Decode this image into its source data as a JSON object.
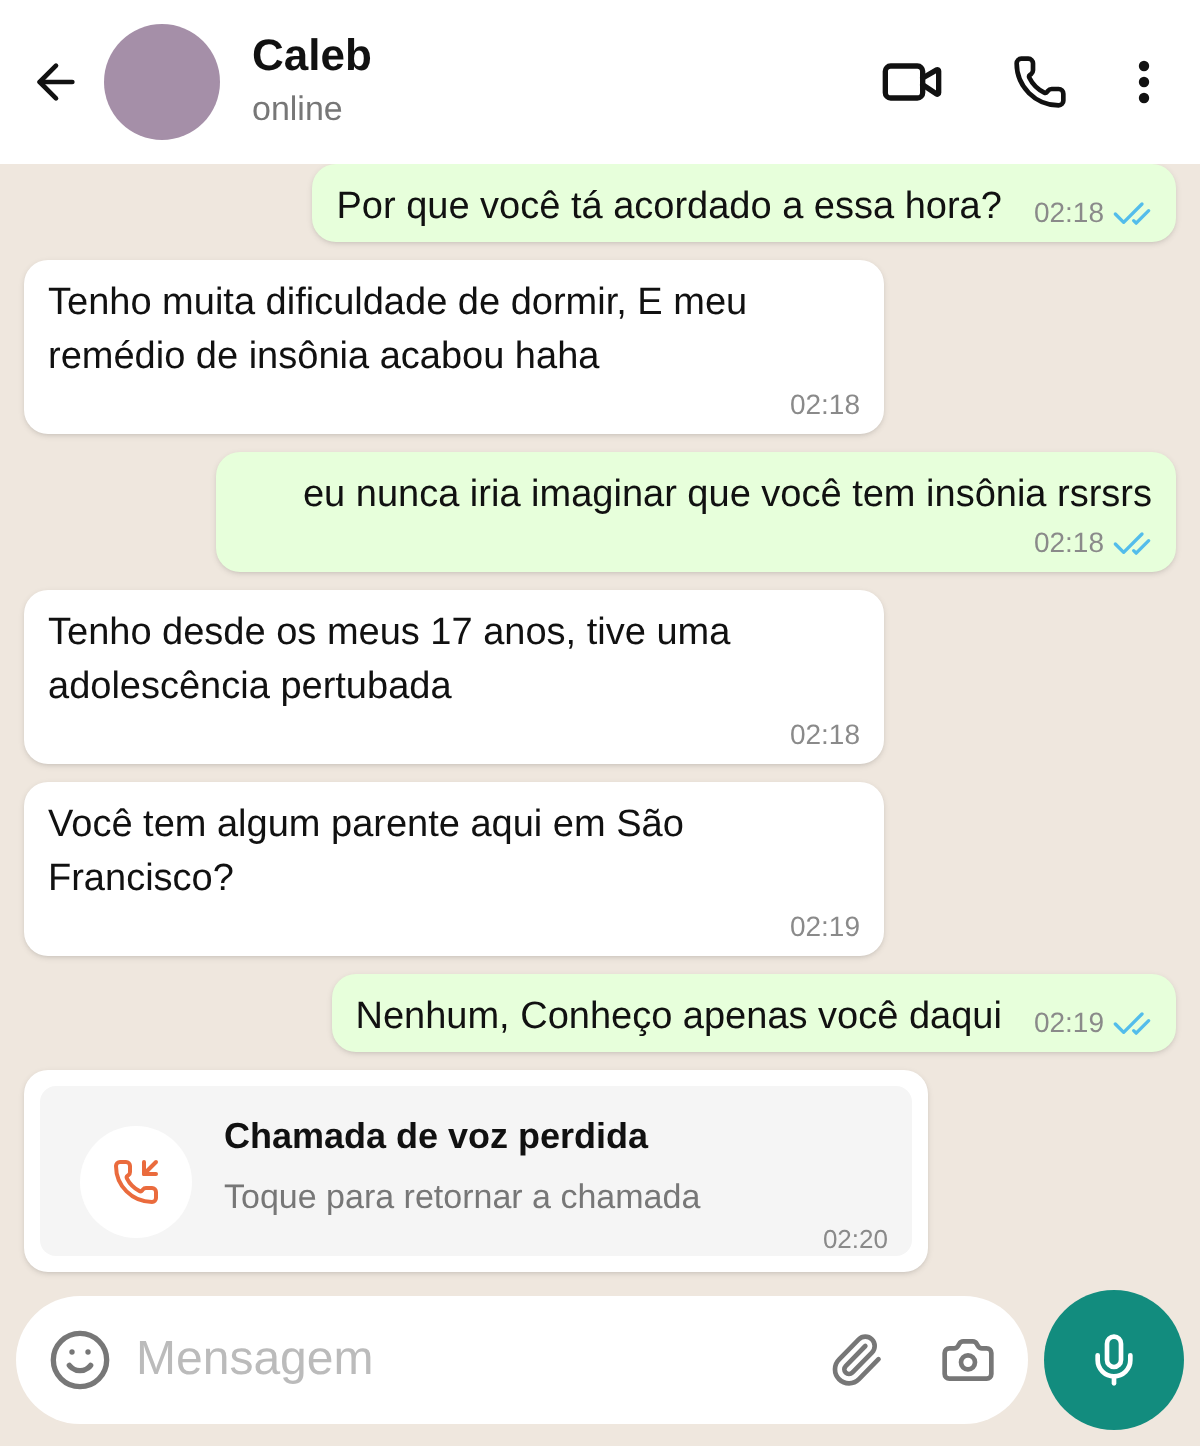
{
  "header": {
    "name": "Caleb",
    "status": "online"
  },
  "messages": [
    {
      "kind": "out",
      "text": "Por que você tá acordado a essa hora?",
      "time": "02:18",
      "read": true
    },
    {
      "kind": "in",
      "text": "Tenho muita dificuldade de dormir, E meu remédio de insônia acabou haha",
      "time": "02:18"
    },
    {
      "kind": "out",
      "text": "eu nunca iria imaginar que você tem insônia rsrsrs",
      "time": "02:18",
      "read": true
    },
    {
      "kind": "in",
      "text": "Tenho desde os meus 17 anos, tive uma adolescência pertubada",
      "time": "02:18"
    },
    {
      "kind": "in",
      "text": "Você tem algum parente aqui em São Francisco?",
      "time": "02:19"
    },
    {
      "kind": "out",
      "text": "Nenhum, Conheço apenas você daqui",
      "time": "02:19",
      "read": true
    },
    {
      "kind": "missed_call",
      "title": "Chamada de voz perdida",
      "subtitle": "Toque para retornar a chamada",
      "time": "02:20"
    }
  ],
  "composer": {
    "placeholder": "Mensagem"
  }
}
